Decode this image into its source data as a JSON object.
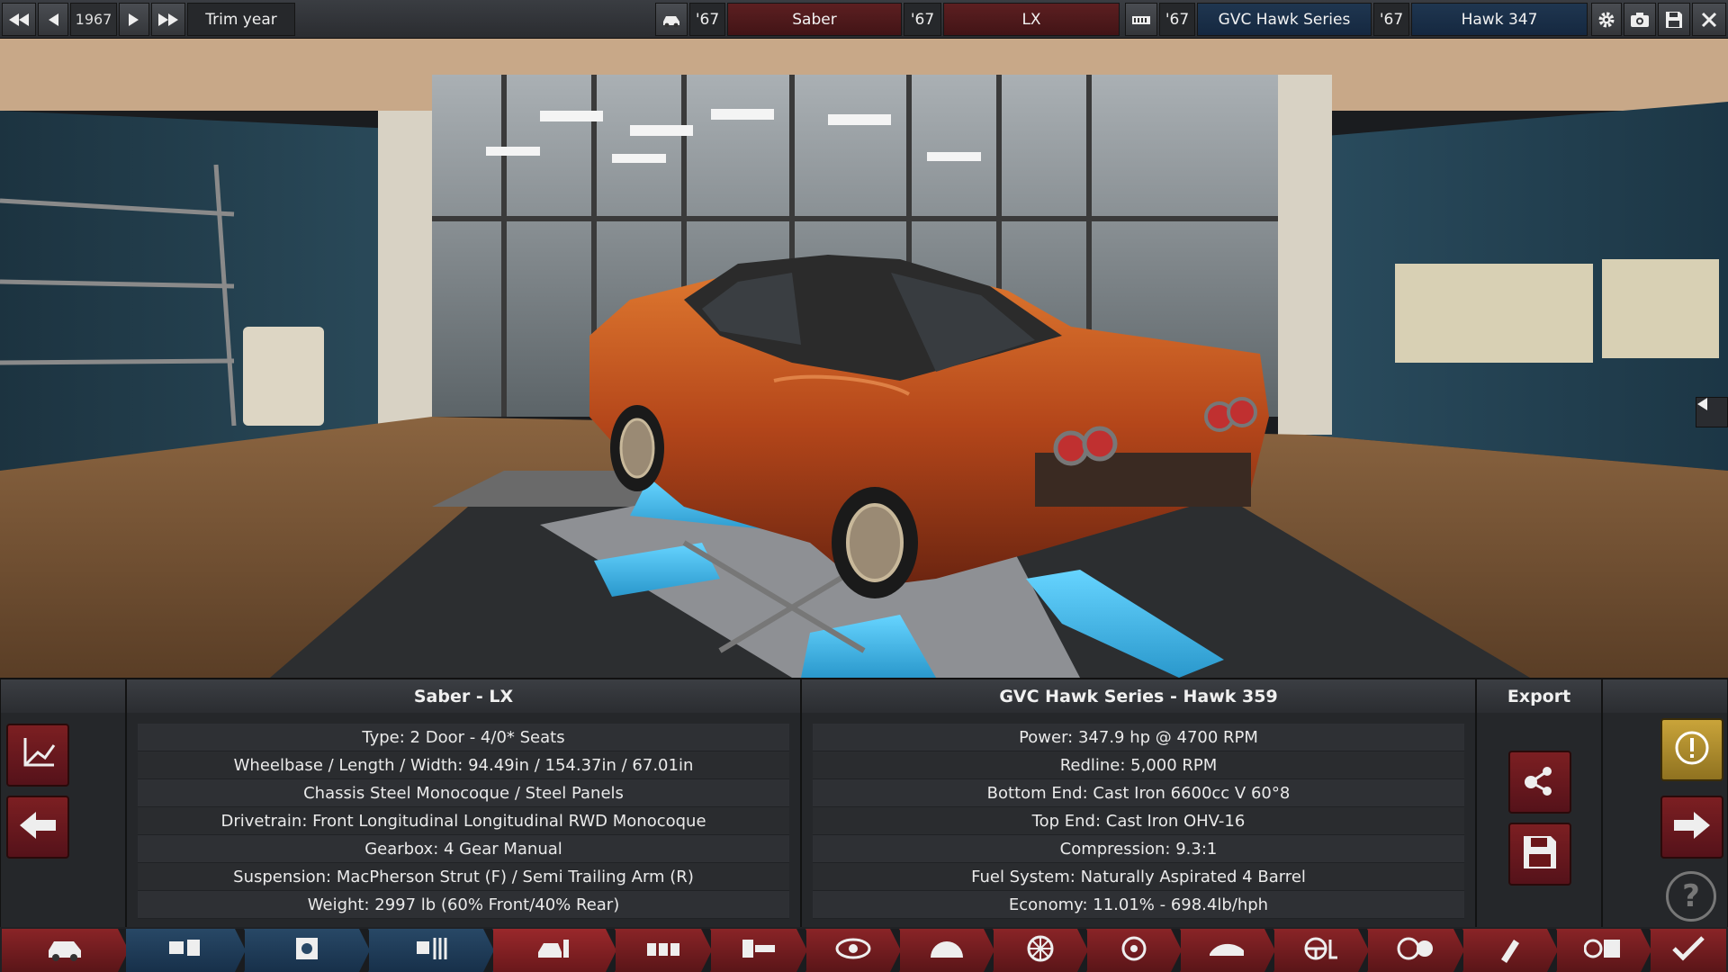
{
  "topbar": {
    "year": "1967",
    "trim_year_label": "Trim year",
    "model_year": "'67",
    "model_name": "Saber",
    "trim_year": "'67",
    "trim_name": "LX",
    "engine_family_year": "'67",
    "engine_family": "GVC Hawk Series",
    "engine_variant_year": "'67",
    "engine_variant": "Hawk 347",
    "icons": [
      "rewind-icon",
      "step-back-icon",
      "step-forward-icon",
      "fast-forward-icon",
      "car-icon",
      "engine-icon",
      "gear-icon",
      "camera-icon",
      "save-icon",
      "close-icon"
    ]
  },
  "panel": {
    "car_title": "Saber - LX",
    "car_rows": [
      "Type: 2 Door - 4/0* Seats",
      "Wheelbase / Length / Width: 94.49in / 154.37in / 67.01in",
      "Chassis Steel Monocoque / Steel Panels",
      "Drivetrain: Front Longitudinal Longitudinal RWD Monocoque",
      "Gearbox: 4 Gear Manual",
      "Suspension: MacPherson Strut (F) / Semi Trailing Arm (R)",
      "Weight: 2997 lb (60% Front/40% Rear)"
    ],
    "engine_title": "GVC Hawk Series - Hawk 359",
    "engine_rows": [
      "Power: 347.9 hp @ 4700 RPM",
      "Redline:  5,000 RPM",
      "Bottom End: Cast Iron 6600cc V 60°8",
      "Top End: Cast Iron OHV-16",
      "Compression: 9.3:1",
      "Fuel System: Naturally Aspirated 4 Barrel",
      "Economy: 11.01% - 698.4lb/hph"
    ],
    "export_title": "Export",
    "help_glyph": "?"
  },
  "colors": {
    "accent_red": "#8a2427",
    "accent_blue": "#1f3650",
    "car_orange": "#c0501a",
    "lift_blue": "#3ab8e8",
    "warning_yellow": "#c9a43a"
  },
  "bottomnav": {
    "tabs": [
      "car-body-icon",
      "engine-block-icon",
      "engine-heads-icon",
      "engine-tune-icon",
      "trim-overview-icon",
      "seats-icon",
      "gearbox-icon",
      "chassis-icon",
      "suspension-icon",
      "wheels-icon",
      "brakes-icon",
      "aero-icon",
      "steering-icon",
      "safety-icon",
      "fuel-icon",
      "test-icon",
      "confirm-icon"
    ]
  }
}
